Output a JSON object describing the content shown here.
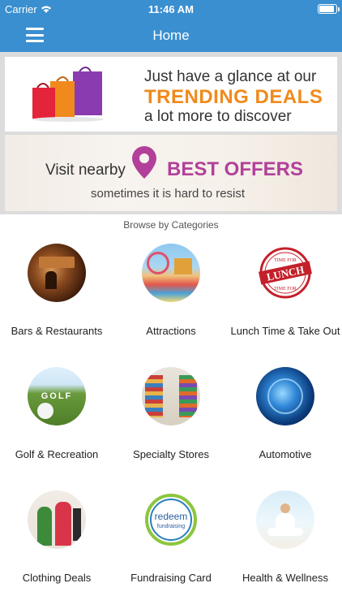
{
  "status_bar": {
    "carrier": "Carrier",
    "time": "11:46 AM"
  },
  "nav": {
    "title": "Home"
  },
  "banner_trending": {
    "line1": "Just have a glance at our",
    "line2": "TRENDING DEALS",
    "line3": "a lot more to discover"
  },
  "banner_offers": {
    "visit": "Visit nearby",
    "best": "BEST OFFERS",
    "sub": "sometimes it is hard to resist"
  },
  "browse_label": "Browse by Categories",
  "categories": [
    {
      "label": "Bars & Restaurants",
      "icon": "bar-photo"
    },
    {
      "label": "Attractions",
      "icon": "amusement-park-photo"
    },
    {
      "label": "Lunch Time & Take Out",
      "icon": "lunch-stamp"
    },
    {
      "label": "Golf & Recreation",
      "icon": "golf-ball-photo"
    },
    {
      "label": "Specialty Stores",
      "icon": "store-aisle-photo"
    },
    {
      "label": "Automotive",
      "icon": "abstract-blue-photo"
    },
    {
      "label": "Clothing Deals",
      "icon": "shopping-women-photo"
    },
    {
      "label": "Fundraising Card",
      "icon": "redeem-fundraising-logo"
    },
    {
      "label": "Health & Wellness",
      "icon": "yoga-photo"
    }
  ],
  "logos": {
    "stamp_text": "LUNCH",
    "stamp_top": "TIME FOR",
    "stamp_bottom": "TIME FOR",
    "golf_text": "GOLF",
    "redeem_text": "redeem",
    "fundraising_text": "fundraising"
  },
  "colors": {
    "header": "#3a8fd0",
    "trending": "#f08a1c",
    "best_offers": "#b2409a"
  }
}
